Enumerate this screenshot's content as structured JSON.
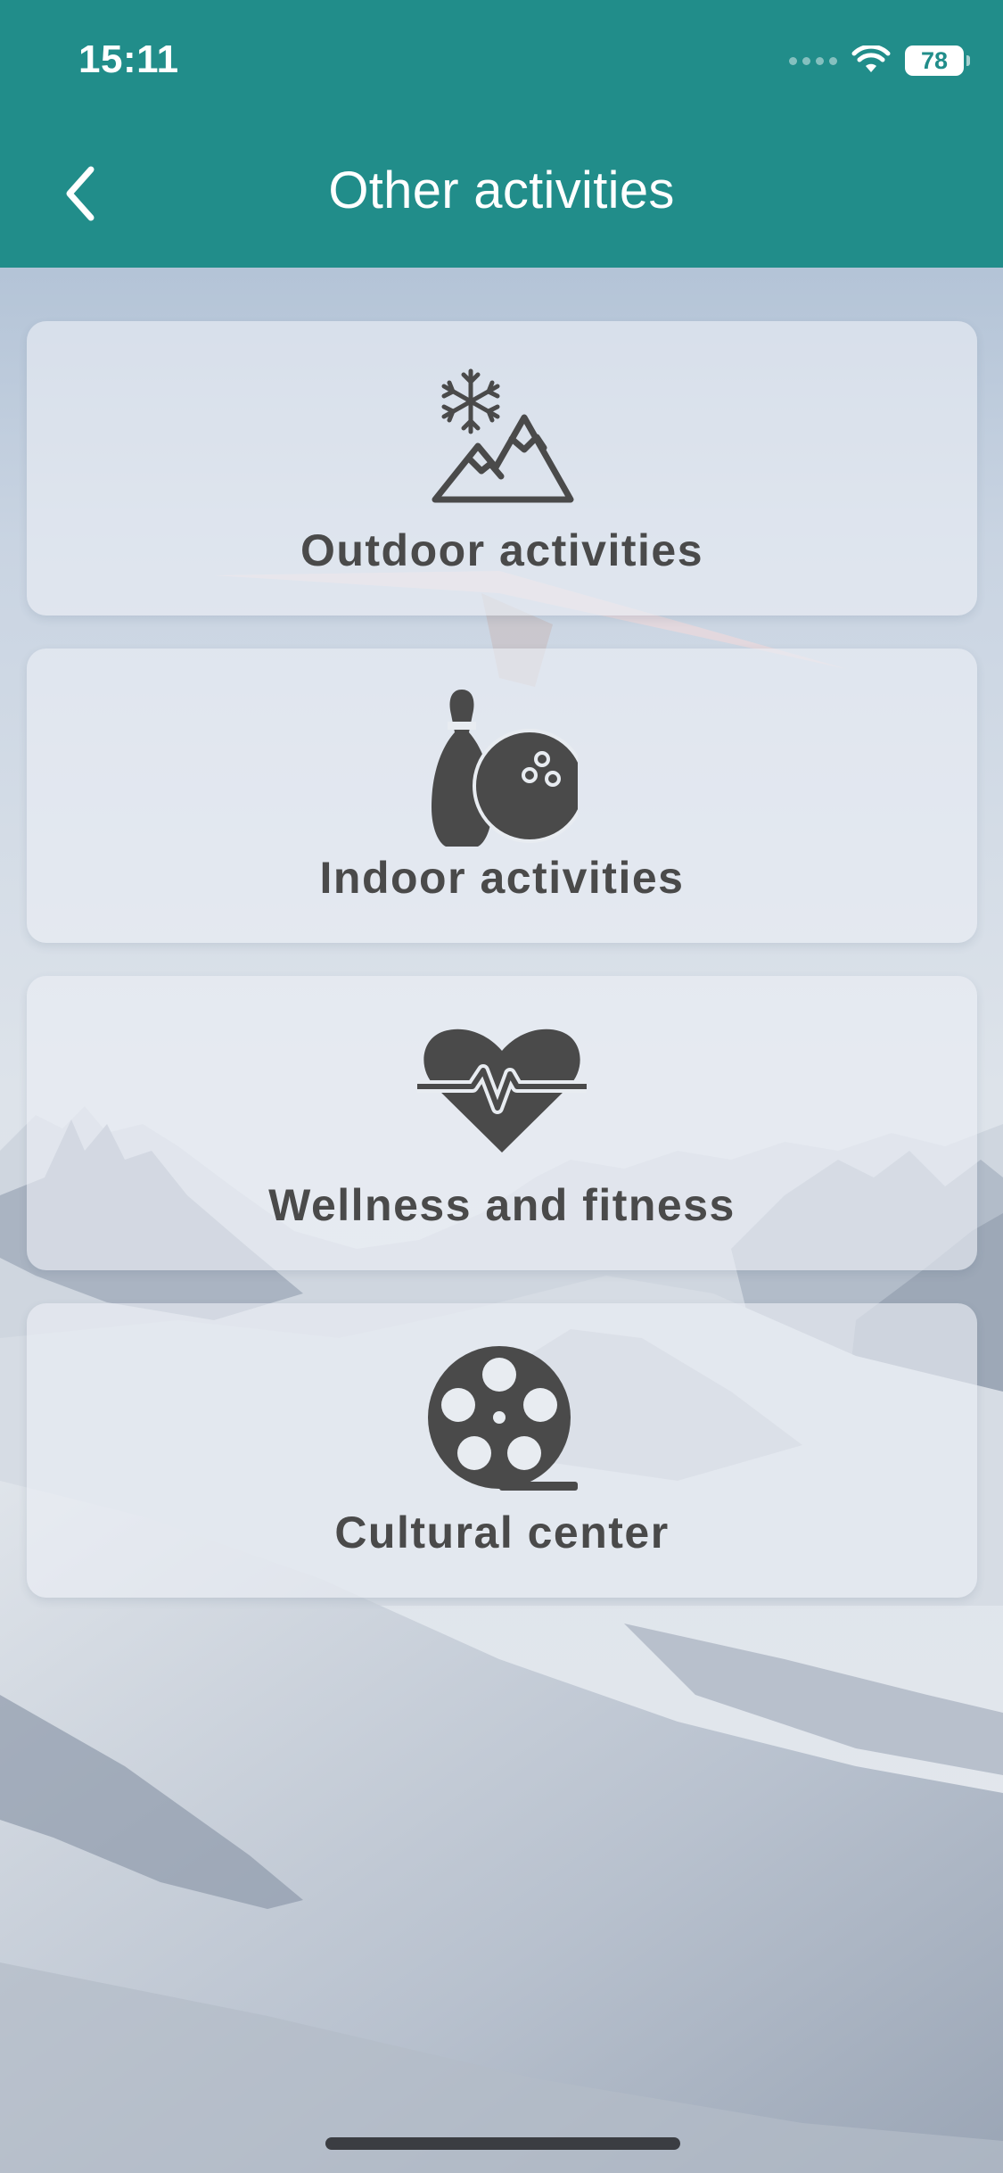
{
  "status_bar": {
    "time": "15:11",
    "battery": "78"
  },
  "header": {
    "title": "Other activities",
    "back_icon": "chevron-left-icon",
    "background_color": "#218d8a"
  },
  "cards": [
    {
      "label": "Outdoor activities",
      "icon": "snow-mountain-icon"
    },
    {
      "label": "Indoor activities",
      "icon": "bowling-icon"
    },
    {
      "label": "Wellness and fitness",
      "icon": "heart-pulse-icon"
    },
    {
      "label": "Cultural center",
      "icon": "film-reel-icon"
    }
  ],
  "colors": {
    "icon": "#4a4a4a",
    "label": "#4a4a4a",
    "card_background": "rgba(235,239,245,0.62)"
  }
}
